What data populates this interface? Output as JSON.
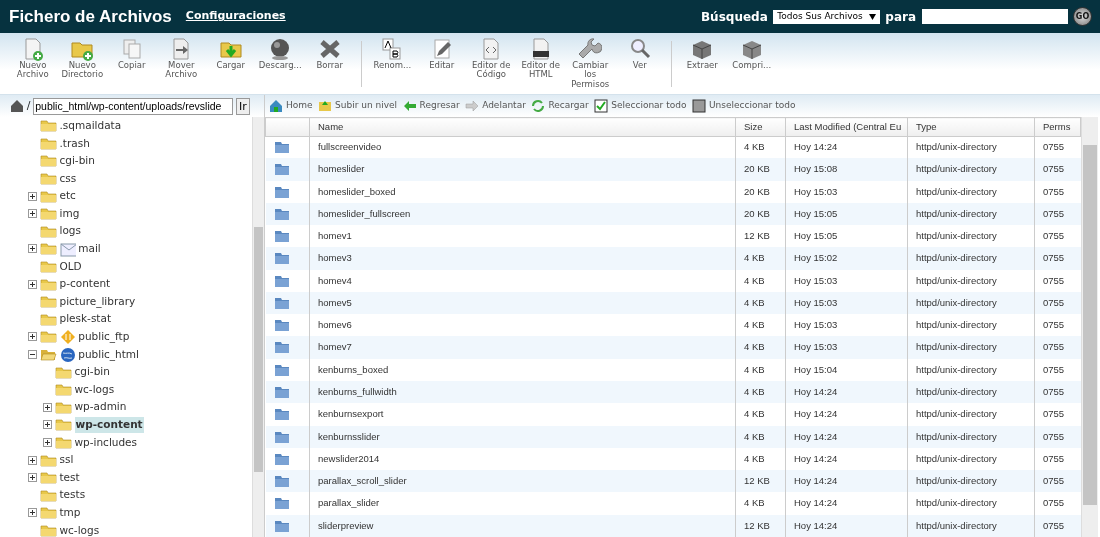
{
  "header": {
    "title": "Fichero de Archivos",
    "settings_link": "Configuraciones",
    "search_label": "Búsqueda",
    "search_scope": "Todos Sus Archivos",
    "for_label": "para",
    "go_button": "GO"
  },
  "toolbar": [
    [
      {
        "label": "Nuevo Archivo"
      },
      {
        "label": "Nuevo Directorio"
      },
      {
        "label": "Copiar"
      },
      {
        "label": "Mover Archivo"
      },
      {
        "label": "Cargar"
      },
      {
        "label": "Descarg..."
      },
      {
        "label": "Borrar"
      }
    ],
    [
      {
        "label": "Renom..."
      },
      {
        "label": "Editar"
      },
      {
        "label": "Editor de Código"
      },
      {
        "label": "Editor de HTML"
      },
      {
        "label": "Cambiar los Permisos"
      },
      {
        "label": "Ver"
      }
    ],
    [
      {
        "label": "Extraer"
      },
      {
        "label": "Compri..."
      }
    ]
  ],
  "path": {
    "separator": "/",
    "value": "public_html/wp-content/uploads/revslide",
    "go_button": "Ir"
  },
  "tree": [
    {
      "label": ".sqmaildata",
      "kind": "folder",
      "expandable": false,
      "expanded": false,
      "selected": false
    },
    {
      "label": ".trash",
      "kind": "folder",
      "expandable": false,
      "expanded": false,
      "selected": false
    },
    {
      "label": "cgi-bin",
      "kind": "folder",
      "expandable": false,
      "expanded": false,
      "selected": false
    },
    {
      "label": "css",
      "kind": "folder",
      "expandable": false,
      "expanded": false,
      "selected": false
    },
    {
      "label": "etc",
      "kind": "folder",
      "expandable": true,
      "expanded": false,
      "selected": false
    },
    {
      "label": "img",
      "kind": "folder",
      "expandable": true,
      "expanded": false,
      "selected": false
    },
    {
      "label": "logs",
      "kind": "folder",
      "expandable": false,
      "expanded": false,
      "selected": false
    },
    {
      "label": "mail",
      "kind": "mail",
      "expandable": true,
      "expanded": false,
      "selected": false
    },
    {
      "label": "OLD",
      "kind": "folder",
      "expandable": false,
      "expanded": false,
      "selected": false
    },
    {
      "label": "p-content",
      "kind": "folder",
      "expandable": true,
      "expanded": false,
      "selected": false
    },
    {
      "label": "picture_library",
      "kind": "folder",
      "expandable": false,
      "expanded": false,
      "selected": false
    },
    {
      "label": "plesk-stat",
      "kind": "folder",
      "expandable": false,
      "expanded": false,
      "selected": false
    },
    {
      "label": "public_ftp",
      "kind": "ftp",
      "expandable": true,
      "expanded": false,
      "selected": false
    },
    {
      "label": "public_html",
      "kind": "web",
      "expandable": true,
      "expanded": true,
      "selected": false,
      "children": [
        {
          "label": "cgi-bin",
          "kind": "folder",
          "expandable": false,
          "expanded": false,
          "selected": false
        },
        {
          "label": "wc-logs",
          "kind": "folder",
          "expandable": false,
          "expanded": false,
          "selected": false
        },
        {
          "label": "wp-admin",
          "kind": "folder",
          "expandable": true,
          "expanded": false,
          "selected": false
        },
        {
          "label": "wp-content",
          "kind": "folder",
          "expandable": true,
          "expanded": false,
          "selected": true
        },
        {
          "label": "wp-includes",
          "kind": "folder",
          "expandable": true,
          "expanded": false,
          "selected": false
        }
      ]
    },
    {
      "label": "ssl",
      "kind": "folder",
      "expandable": true,
      "expanded": false,
      "selected": false
    },
    {
      "label": "test",
      "kind": "folder",
      "expandable": true,
      "expanded": false,
      "selected": false
    },
    {
      "label": "tests",
      "kind": "folder",
      "expandable": false,
      "expanded": false,
      "selected": false
    },
    {
      "label": "tmp",
      "kind": "folder",
      "expandable": true,
      "expanded": false,
      "selected": false
    },
    {
      "label": "wc-logs",
      "kind": "folder",
      "expandable": false,
      "expanded": false,
      "selected": false
    }
  ],
  "nav": [
    {
      "label": "Home"
    },
    {
      "label": "Subir un nivel"
    },
    {
      "label": "Regresar"
    },
    {
      "label": "Adelantar"
    },
    {
      "label": "Recargar"
    },
    {
      "label": "Seleccionar todo"
    },
    {
      "label": "Unseleccionar todo"
    }
  ],
  "table": {
    "columns": [
      "Name",
      "Size",
      "Last Modified (Central Eu",
      "Type",
      "Perms"
    ],
    "rows": [
      [
        "fullscreenvideo",
        "4 KB",
        "Hoy 14:24",
        "httpd/unix-directory",
        "0755"
      ],
      [
        "homeslider",
        "20 KB",
        "Hoy 15:08",
        "httpd/unix-directory",
        "0755"
      ],
      [
        "homeslider_boxed",
        "20 KB",
        "Hoy 15:03",
        "httpd/unix-directory",
        "0755"
      ],
      [
        "homeslider_fullscreen",
        "20 KB",
        "Hoy 15:05",
        "httpd/unix-directory",
        "0755"
      ],
      [
        "homev1",
        "12 KB",
        "Hoy 15:05",
        "httpd/unix-directory",
        "0755"
      ],
      [
        "homev3",
        "4 KB",
        "Hoy 15:02",
        "httpd/unix-directory",
        "0755"
      ],
      [
        "homev4",
        "4 KB",
        "Hoy 15:03",
        "httpd/unix-directory",
        "0755"
      ],
      [
        "homev5",
        "4 KB",
        "Hoy 15:03",
        "httpd/unix-directory",
        "0755"
      ],
      [
        "homev6",
        "4 KB",
        "Hoy 15:03",
        "httpd/unix-directory",
        "0755"
      ],
      [
        "homev7",
        "4 KB",
        "Hoy 15:03",
        "httpd/unix-directory",
        "0755"
      ],
      [
        "kenburns_boxed",
        "4 KB",
        "Hoy 15:04",
        "httpd/unix-directory",
        "0755"
      ],
      [
        "kenburns_fullwidth",
        "4 KB",
        "Hoy 14:24",
        "httpd/unix-directory",
        "0755"
      ],
      [
        "kenburnsexport",
        "4 KB",
        "Hoy 14:24",
        "httpd/unix-directory",
        "0755"
      ],
      [
        "kenburnsslider",
        "4 KB",
        "Hoy 14:24",
        "httpd/unix-directory",
        "0755"
      ],
      [
        "newslider2014",
        "4 KB",
        "Hoy 14:24",
        "httpd/unix-directory",
        "0755"
      ],
      [
        "parallax_scroll_slider",
        "12 KB",
        "Hoy 14:24",
        "httpd/unix-directory",
        "0755"
      ],
      [
        "parallax_slider",
        "4 KB",
        "Hoy 14:24",
        "httpd/unix-directory",
        "0755"
      ],
      [
        "sliderpreview",
        "12 KB",
        "Hoy 14:24",
        "httpd/unix-directory",
        "0755"
      ]
    ]
  }
}
